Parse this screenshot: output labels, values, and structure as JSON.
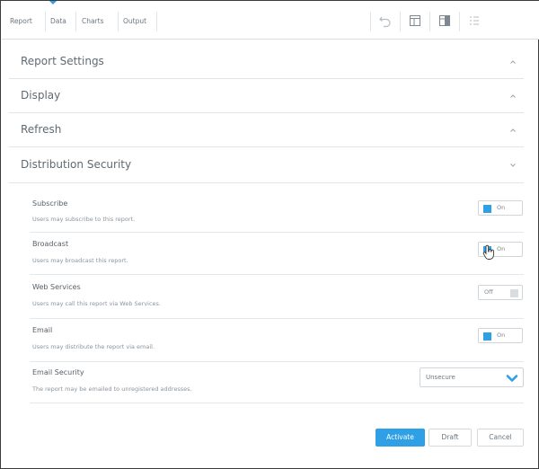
{
  "toolbar": {
    "tabs": [
      {
        "label": "Report"
      },
      {
        "label": "Data"
      },
      {
        "label": "Charts"
      },
      {
        "label": "Output"
      }
    ],
    "tools": [
      "undo-icon",
      "layout-icon",
      "panel-icon",
      "list-icon"
    ]
  },
  "sections": [
    {
      "title": "Report Settings",
      "state": "collapsed"
    },
    {
      "title": "Display",
      "state": "collapsed"
    },
    {
      "title": "Refresh",
      "state": "collapsed"
    },
    {
      "title": "Distribution Security",
      "state": "expanded"
    }
  ],
  "settings": [
    {
      "label": "Subscribe",
      "description": "Users may subscribe to this report.",
      "toggle": "On"
    },
    {
      "label": "Broadcast",
      "description": "Users may broadcast this report.",
      "toggle": "On"
    },
    {
      "label": "Web Services",
      "description": "Users may call this report via Web Services.",
      "toggle": "Off"
    },
    {
      "label": "Email",
      "description": "Users may distribute the report via email.",
      "toggle": "On"
    }
  ],
  "email_security": {
    "label": "Email Security",
    "description": "The report may be emailed to unregistered addresses.",
    "value": "Unsecure"
  },
  "actions": {
    "activate": "Activate",
    "draft": "Draft",
    "cancel": "Cancel"
  },
  "colors": {
    "accent": "#2f9fe6",
    "text": "#5f6a73",
    "border": "#e1e5e8"
  }
}
